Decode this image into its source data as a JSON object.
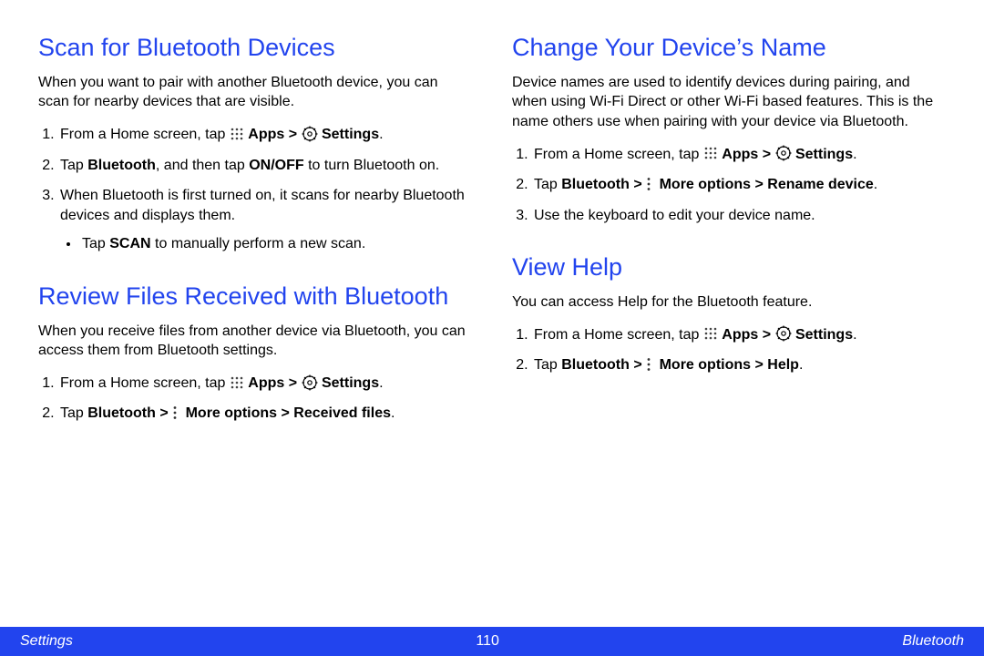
{
  "left": {
    "scan": {
      "heading": "Scan for Bluetooth Devices",
      "desc": "When you want to pair with another Bluetooth device, you can scan for nearby devices that are visible.",
      "step1_prefix": "From a Home screen, tap ",
      "apps_label": "Apps > ",
      "settings_label": "Settings",
      "step2_a": "Tap ",
      "step2_bt": "Bluetooth",
      "step2_b": ", and then tap ",
      "step2_onoff": "ON/OFF",
      "step2_c": " to turn Bluetooth on.",
      "step3": "When Bluetooth is first turned on, it scans for nearby Bluetooth devices and displays them.",
      "bullet_a": "Tap ",
      "bullet_scan": "SCAN",
      "bullet_b": " to manually perform a new scan."
    },
    "review": {
      "heading": "Review Files Received with Bluetooth",
      "desc": "When you receive files from another device via Bluetooth, you can access them from Bluetooth settings.",
      "step1_prefix": "From a Home screen, tap ",
      "apps_label": "Apps > ",
      "settings_label": "Settings",
      "step2_a": "Tap ",
      "step2_bt": "Bluetooth > ",
      "step2_more": "More options > Received files",
      "step2_dot": "."
    }
  },
  "right": {
    "change": {
      "heading": "Change Your Device’s Name",
      "desc": "Device names are used to identify devices during pairing, and when using Wi-Fi Direct or other Wi-Fi based features. This is the name others use when pairing with your device via Bluetooth.",
      "step1_prefix": "From a Home screen, tap ",
      "apps_label": "Apps > ",
      "settings_label": "Settings",
      "step2_a": "Tap ",
      "step2_bt": "Bluetooth > ",
      "step2_more": "More options > Rename device",
      "step2_dot": ".",
      "step3": "Use the keyboard to edit your device name."
    },
    "help": {
      "heading": "View Help",
      "desc": "You can access Help for the Bluetooth feature.",
      "step1_prefix": "From a Home screen, tap ",
      "apps_label": "Apps > ",
      "settings_label": "Settings",
      "step2_a": "Tap ",
      "step2_bt": "Bluetooth > ",
      "step2_more": "More options > Help",
      "step2_dot": "."
    }
  },
  "footer": {
    "left": "Settings",
    "center": "110",
    "right": "Bluetooth"
  }
}
